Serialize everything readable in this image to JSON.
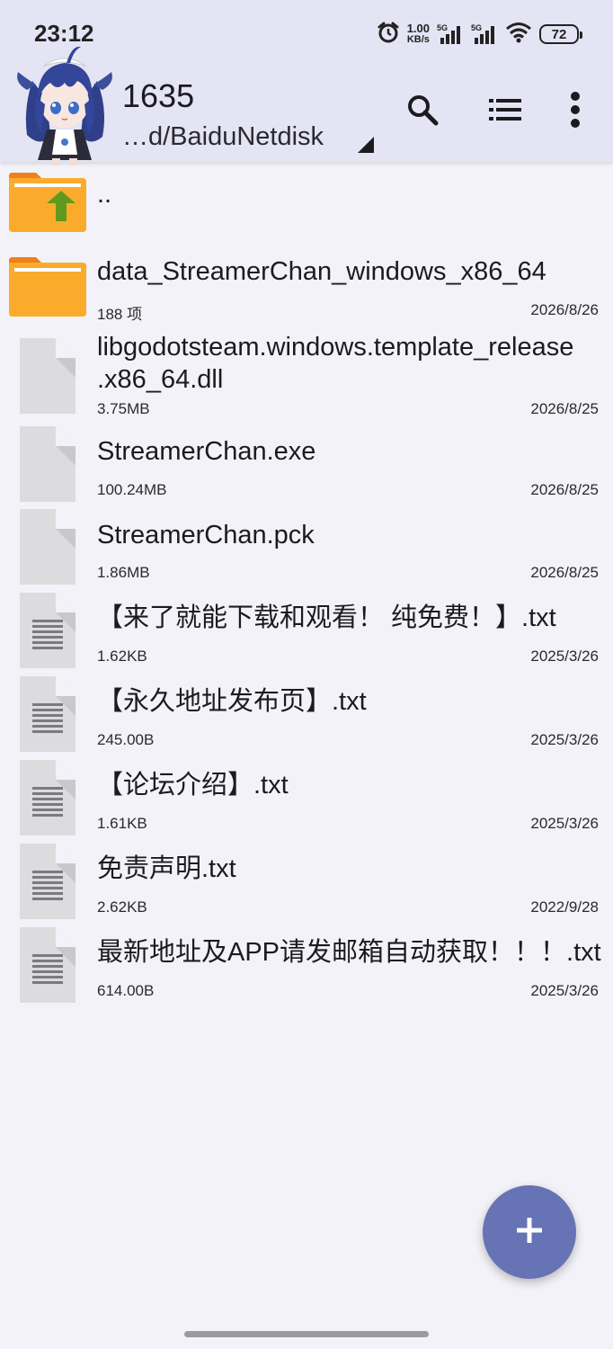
{
  "status": {
    "time": "23:12",
    "net_speed_value": "1.00",
    "net_speed_unit": "KB/s",
    "sim1_tag": "5G",
    "sim2_tag": "5G",
    "battery": "72"
  },
  "toolbar": {
    "title": "1635",
    "path": "…d/BaiduNetdisk",
    "icons": [
      "search-icon",
      "sort-list-icon",
      "more-vert-icon"
    ]
  },
  "files": [
    {
      "type": "parent-folder",
      "name": "..",
      "meta": "",
      "date": ""
    },
    {
      "type": "folder",
      "name": "data_StreamerChan_windows_x86_64",
      "meta": "188 项",
      "date": "2026/8/26"
    },
    {
      "type": "file",
      "name_line1": "libgodotsteam.windows.template_release",
      "name_line2": ".x86_64.dll",
      "meta": "3.75MB",
      "date": "2026/8/25"
    },
    {
      "type": "file",
      "name": "StreamerChan.exe",
      "meta": "100.24MB",
      "date": "2026/8/25"
    },
    {
      "type": "file",
      "name": "StreamerChan.pck",
      "meta": "1.86MB",
      "date": "2026/8/25"
    },
    {
      "type": "text",
      "name": "【来了就能下载和观看！ 纯免费！】.txt",
      "meta": "1.62KB",
      "date": "2025/3/26"
    },
    {
      "type": "text",
      "name": "【永久地址发布页】.txt",
      "meta": "245.00B",
      "date": "2025/3/26"
    },
    {
      "type": "text",
      "name": "【论坛介绍】.txt",
      "meta": "1.61KB",
      "date": "2025/3/26"
    },
    {
      "type": "text",
      "name": "免责声明.txt",
      "meta": "2.62KB",
      "date": "2022/9/28"
    },
    {
      "type": "text",
      "name": "最新地址及APP请发邮箱自动获取！！！.txt",
      "meta": "614.00B",
      "date": "2025/3/26"
    }
  ],
  "fab": {
    "icon": "plus-icon"
  },
  "colors": {
    "topbar": "#e4e4f4",
    "background": "#f3f2f8",
    "folder": "#fbab2c",
    "folder_tab": "#f07f1c",
    "up_arrow": "#5e9a1e",
    "fab": "#6673b4"
  }
}
